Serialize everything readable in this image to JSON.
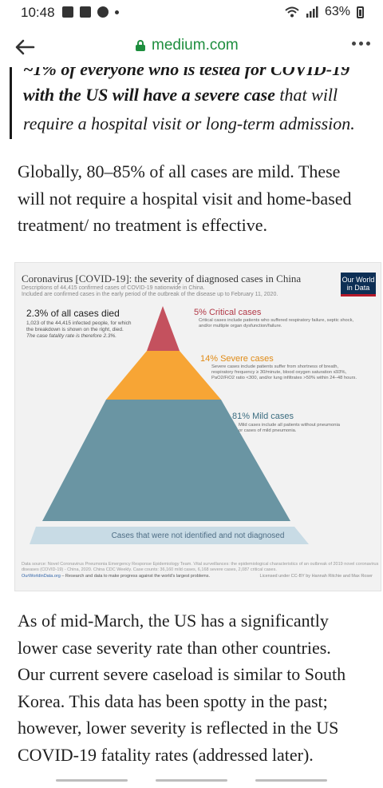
{
  "status_bar": {
    "time": "10:48",
    "battery": "63%"
  },
  "browser": {
    "url": "medium.com"
  },
  "article": {
    "quote_lines": [
      "~1% of everyone who is tested for COVID-19",
      "with the US will have a severe case that will",
      "require a hospital visit or long-term admission."
    ],
    "paragraph1": [
      "Globally, 80–85% of all cases are mild. These",
      "will not require a hospital visit and home-based",
      "treatment/ no treatment is effective."
    ],
    "paragraph2": [
      "As of mid-March, the US has a significantly",
      "lower case severity rate than other countries.",
      "Our current severe caseload is similar to South",
      "Korea. This data has been spotty in the past;",
      "however, lower severity is reflected in the US",
      "COVID-19 fatality rates (addressed later)."
    ]
  },
  "figure": {
    "title": "Coronavirus [COVID-19]: the severity of diagnosed cases in China",
    "subtitle_lines": [
      "Descriptions of 44,415 confirmed cases of COVID-19 nationwide in China.",
      "Included are confirmed cases in the early period of the outbreak of the disease up to February 11, 2020."
    ],
    "logo_lines": [
      "Our World",
      "in Data"
    ],
    "died": {
      "title": "2.3% of all cases died",
      "lines": [
        "1,023 of the 44,415 infected people, for which",
        "the breakdown is shown on the right, died.",
        "The case fatality rate is therefore 2.3%."
      ]
    },
    "tiers": [
      {
        "label": "5% Critical cases",
        "value": 5,
        "color": "#c4515e",
        "desc": [
          "Critical cases include patients who suffered respiratory failure, septic shock,",
          "and/or multiple organ dysfunction/failure."
        ]
      },
      {
        "label": "14% Severe cases",
        "value": 14,
        "color": "#f7a535",
        "desc": [
          "Severe cases include patients suffer from shortness of breath,",
          "respiratory frequency ≥ 30/minute, blood oxygen saturation ≤93%,",
          "PaO2/FiO2 ratio <300, and/or lung infiltrates >50% within 24–48 hours."
        ]
      },
      {
        "label": "81% Mild cases",
        "value": 81,
        "color": "#6a95a3",
        "desc": [
          "Mild cases include all patients without pneumonia",
          "or cases of mild pneumonia."
        ]
      }
    ],
    "undiagnosed_label": "Cases that were not identified and not diagnosed",
    "undiagnosed_color": "#c8dbe5",
    "source_lines": [
      "Data source: Novel Coronavirus Pneumonia Emergency Response Epidemiology Team. Vital surveillances: the epidemiological characteristics of an outbreak of 2019 novel coronavirus",
      "diseases (COVID-19) - China, 2020. China CDC Weekly. Case counts: 36,160 mild cases, 6,168 severe cases, 2,087 critical cases."
    ],
    "site_link": "OurWorldinData.org",
    "site_tagline": " – Research and data to make progress against the world's largest problems.",
    "license": "Licensed under CC-BY by Hannah Ritchie and Max Roser"
  }
}
